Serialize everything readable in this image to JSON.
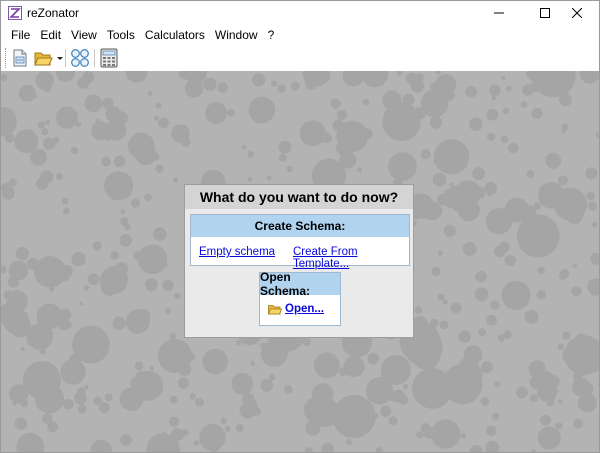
{
  "window": {
    "title": "reZonator"
  },
  "menubar": {
    "items": [
      "File",
      "Edit",
      "View",
      "Tools",
      "Calculators",
      "Window",
      "?"
    ]
  },
  "toolbar": {
    "buttons": [
      "new-schema-icon",
      "open-folder-icon",
      "elements-icon",
      "calculator-icon"
    ]
  },
  "dialog": {
    "title": "What do you want to do now?",
    "create": {
      "header": "Create Schema:",
      "empty_label": "Empty schema",
      "template_label": "Create From Template..."
    },
    "open": {
      "header": "Open Schema:",
      "open_label": "Open..."
    }
  },
  "colors": {
    "workspace": "#b3b3b3",
    "panel_header": "#b0d4f0",
    "link": "#0a0ad8"
  }
}
